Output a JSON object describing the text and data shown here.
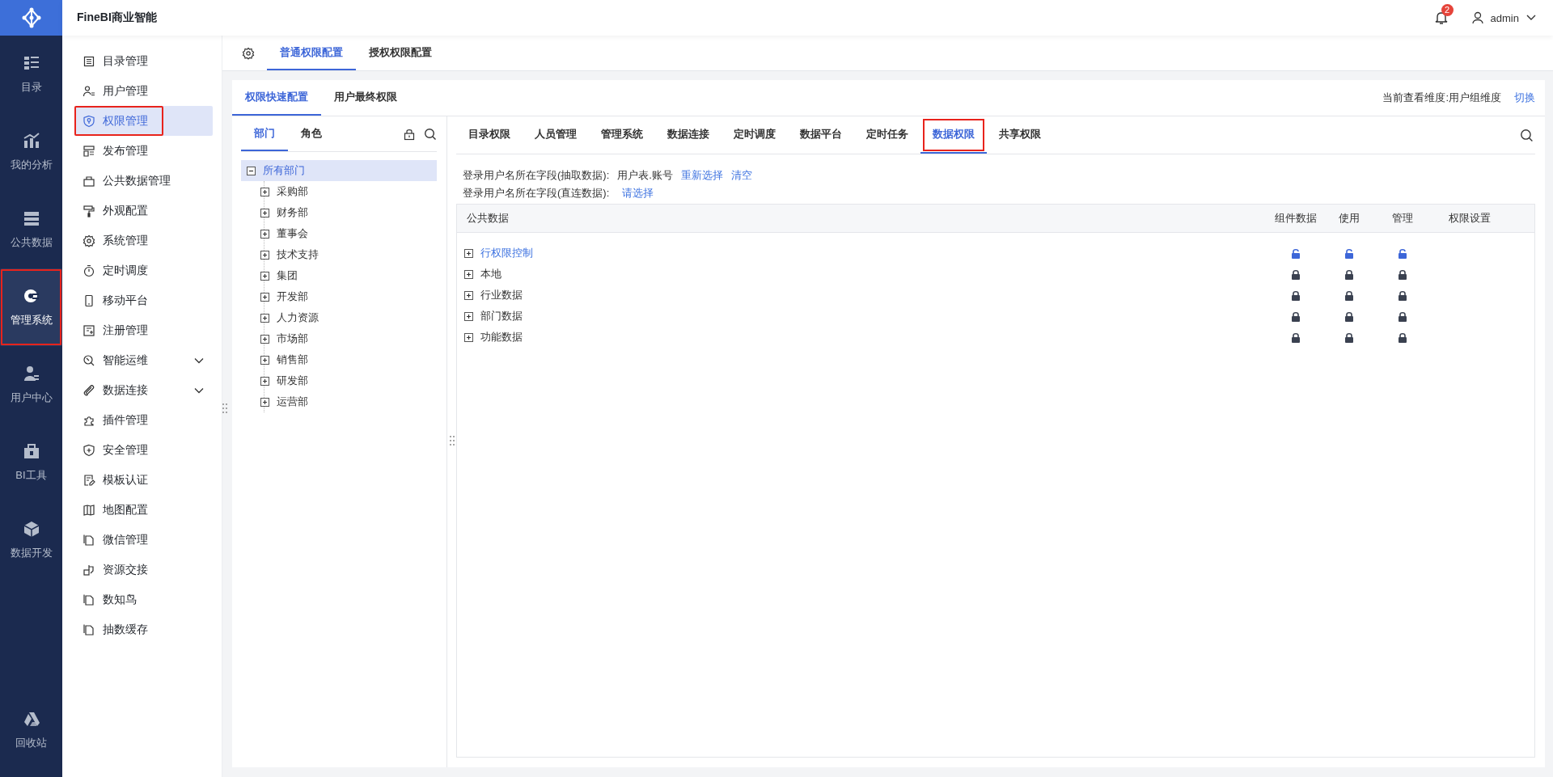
{
  "app": {
    "title": "FineBI商业智能"
  },
  "header": {
    "notification_count": "2",
    "user": "admin"
  },
  "nav_rail": [
    {
      "label": "目录",
      "selected": false,
      "highlighted": false
    },
    {
      "label": "我的分析",
      "selected": false,
      "highlighted": false
    },
    {
      "label": "公共数据",
      "selected": false,
      "highlighted": false
    },
    {
      "label": "管理系统",
      "selected": true,
      "highlighted": true
    },
    {
      "label": "用户中心",
      "selected": false,
      "highlighted": false
    },
    {
      "label": "BI工具",
      "selected": false,
      "highlighted": false
    },
    {
      "label": "数据开发",
      "selected": false,
      "highlighted": false
    },
    {
      "label": "回收站",
      "selected": false,
      "highlighted": false
    }
  ],
  "sidebar": {
    "items": [
      {
        "label": "目录管理",
        "selected": false,
        "highlighted": false,
        "expandable": false
      },
      {
        "label": "用户管理",
        "selected": false,
        "highlighted": false,
        "expandable": false
      },
      {
        "label": "权限管理",
        "selected": true,
        "highlighted": true,
        "expandable": false
      },
      {
        "label": "发布管理",
        "selected": false,
        "highlighted": false,
        "expandable": false
      },
      {
        "label": "公共数据管理",
        "selected": false,
        "highlighted": false,
        "expandable": false
      },
      {
        "label": "外观配置",
        "selected": false,
        "highlighted": false,
        "expandable": false
      },
      {
        "label": "系统管理",
        "selected": false,
        "highlighted": false,
        "expandable": false
      },
      {
        "label": "定时调度",
        "selected": false,
        "highlighted": false,
        "expandable": false
      },
      {
        "label": "移动平台",
        "selected": false,
        "highlighted": false,
        "expandable": false
      },
      {
        "label": "注册管理",
        "selected": false,
        "highlighted": false,
        "expandable": false
      },
      {
        "label": "智能运维",
        "selected": false,
        "highlighted": false,
        "expandable": true
      },
      {
        "label": "数据连接",
        "selected": false,
        "highlighted": false,
        "expandable": true
      },
      {
        "label": "插件管理",
        "selected": false,
        "highlighted": false,
        "expandable": false
      },
      {
        "label": "安全管理",
        "selected": false,
        "highlighted": false,
        "expandable": false
      },
      {
        "label": "模板认证",
        "selected": false,
        "highlighted": false,
        "expandable": false
      },
      {
        "label": "地图配置",
        "selected": false,
        "highlighted": false,
        "expandable": false
      },
      {
        "label": "微信管理",
        "selected": false,
        "highlighted": false,
        "expandable": false
      },
      {
        "label": "资源交接",
        "selected": false,
        "highlighted": false,
        "expandable": false
      },
      {
        "label": "数知鸟",
        "selected": false,
        "highlighted": false,
        "expandable": false
      },
      {
        "label": "抽数缓存",
        "selected": false,
        "highlighted": false,
        "expandable": false
      }
    ]
  },
  "top_tabs": [
    {
      "label": "普通权限配置",
      "selected": true
    },
    {
      "label": "授权权限配置",
      "selected": false
    }
  ],
  "sub_tabs": [
    {
      "label": "权限快速配置",
      "selected": true
    },
    {
      "label": "用户最终权限",
      "selected": false
    }
  ],
  "dimension": {
    "label": "当前查看维度:用户组维度",
    "action": "切换"
  },
  "group_tabs": [
    {
      "label": "部门",
      "selected": true
    },
    {
      "label": "角色",
      "selected": false
    }
  ],
  "tree": [
    {
      "label": "所有部门",
      "expanded": true,
      "selected": true,
      "children": [
        {
          "label": "采购部",
          "expanded": false,
          "selected": false
        },
        {
          "label": "财务部",
          "expanded": false,
          "selected": false
        },
        {
          "label": "董事会",
          "expanded": false,
          "selected": false
        },
        {
          "label": "技术支持",
          "expanded": false,
          "selected": false
        },
        {
          "label": "集团",
          "expanded": false,
          "selected": false
        },
        {
          "label": "开发部",
          "expanded": false,
          "selected": false
        },
        {
          "label": "人力资源",
          "expanded": false,
          "selected": false
        },
        {
          "label": "市场部",
          "expanded": false,
          "selected": false
        },
        {
          "label": "销售部",
          "expanded": false,
          "selected": false
        },
        {
          "label": "研发部",
          "expanded": false,
          "selected": false
        },
        {
          "label": "运营部",
          "expanded": false,
          "selected": false
        }
      ]
    }
  ],
  "permission_tabs": [
    {
      "label": "目录权限",
      "selected": false,
      "highlighted": false
    },
    {
      "label": "人员管理",
      "selected": false,
      "highlighted": false
    },
    {
      "label": "管理系统",
      "selected": false,
      "highlighted": false
    },
    {
      "label": "数据连接",
      "selected": false,
      "highlighted": false
    },
    {
      "label": "定时调度",
      "selected": false,
      "highlighted": false
    },
    {
      "label": "数据平台",
      "selected": false,
      "highlighted": false
    },
    {
      "label": "定时任务",
      "selected": false,
      "highlighted": false
    },
    {
      "label": "数据权限",
      "selected": true,
      "highlighted": true
    },
    {
      "label": "共享权限",
      "selected": false,
      "highlighted": false
    }
  ],
  "login_fields": [
    {
      "label": "登录用户名所在字段(抽取数据):",
      "value": "用户表.账号",
      "links": [
        "重新选择",
        "清空"
      ]
    },
    {
      "label": "登录用户名所在字段(直连数据):",
      "links": [
        "请选择"
      ]
    }
  ],
  "table": {
    "columns": [
      "公共数据",
      "组件数据",
      "使用",
      "管理",
      "权限设置"
    ],
    "rows": [
      {
        "name": "行权限控制",
        "expanded": false,
        "active": true,
        "permissions": [
          {
            "locked": false
          },
          {
            "locked": false
          },
          {
            "locked": false
          }
        ]
      },
      {
        "name": "本地",
        "expanded": false,
        "active": false,
        "permissions": [
          {
            "locked": true
          },
          {
            "locked": true
          },
          {
            "locked": true
          }
        ]
      },
      {
        "name": "行业数据",
        "expanded": false,
        "active": false,
        "permissions": [
          {
            "locked": true
          },
          {
            "locked": true
          },
          {
            "locked": true
          }
        ]
      },
      {
        "name": "部门数据",
        "expanded": false,
        "active": false,
        "permissions": [
          {
            "locked": true
          },
          {
            "locked": true
          },
          {
            "locked": true
          }
        ]
      },
      {
        "name": "功能数据",
        "expanded": false,
        "active": false,
        "permissions": [
          {
            "locked": true
          },
          {
            "locked": true
          },
          {
            "locked": true
          }
        ]
      }
    ]
  }
}
